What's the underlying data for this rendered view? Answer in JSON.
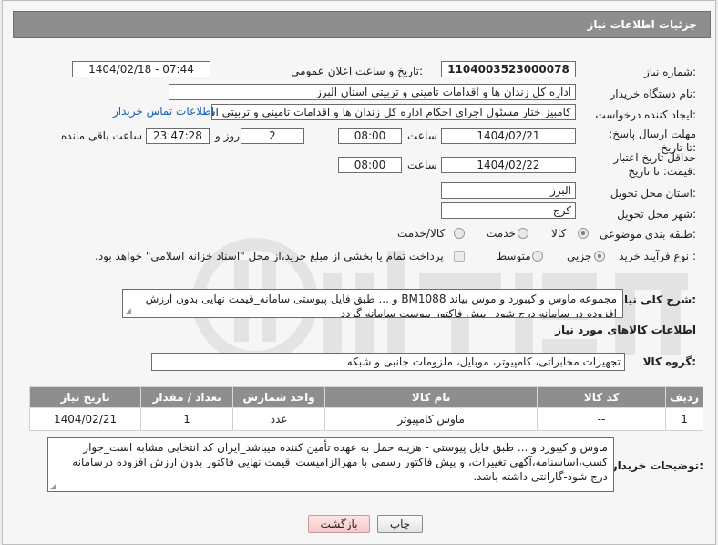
{
  "header": {
    "title": "جزئیات اطلاعات نیاز"
  },
  "labels": {
    "need_number": "شماره نیاز:",
    "announce_datetime": "تاریخ و ساعت اعلان عمومی:",
    "buyer_org": "نام دستگاه خریدار:",
    "requester": "ایجاد کننده درخواست:",
    "reply_deadline": "مهلت ارسال پاسخ: تا تاریخ:",
    "price_validity": "حداقل تاریخ اعتبار قیمت: تا تاریخ:",
    "time": "ساعت",
    "day_and": "روز و",
    "remaining": "ساعت باقی مانده",
    "province": "استان محل تحویل:",
    "city": "شهر محل تحویل:",
    "category": "طبقه بندی موضوعی:",
    "process_type": "نوع فرآیند خرید :",
    "need_desc": "شرح کلی نیاز:",
    "goods_info": "اطلاعات کالاهای مورد نیاز",
    "goods_group": "گروه کالا:",
    "buyer_notes": "توضیحات خریدار:"
  },
  "fields": {
    "need_number": "1104003523000078",
    "announce_datetime": "1404/02/18 - 07:44",
    "buyer_org": "اداره کل زندان ها و اقدامات تامینی و تربیتی استان البرز",
    "requester": "کامبیز ختار مسئول اجرای احکام اداره کل زندان ها و اقدامات تامینی و تربیتی استان البرز",
    "reply_date": "1404/02/21",
    "reply_time": "08:00",
    "reply_days": "2",
    "remaining_time": "23:47:28",
    "validity_date": "1404/02/22",
    "validity_time": "08:00",
    "province": "البرز",
    "city": "کرج",
    "need_desc": "مجموعه ماوس و کیبورد و موس بیاند BM1088 و ... طبق فایل پیوستی سامانه_قیمت نهایی بدون ارزش افزوده در سامانه درج شود_ پیش فاکتور پیوست سامانه گردد",
    "goods_group": "تجهیزات مخابراتی، کامپیوتر، موبایل، ملزومات جانبی و شبکه",
    "buyer_notes": "ماوس و کیبورد و ... طبق فایل پیوستی - هزینه حمل به عهده تأمین کننده میباشد_ایران کد انتخابی مشابه است_جواز کسب،اساسنامه،آگهی تغییرات، و پیش فاکتور رسمی با مهرالزامیست_قیمت نهایی فاکتور بدون ارزش افزوده درسامانه درج شود-گارانتی داشته باشد."
  },
  "contact_link": "اطلاعات تماس خریدار",
  "category_options": {
    "goods": "کالا",
    "service": "خدمت",
    "goods_service": "کالا/خدمت",
    "selected": "goods"
  },
  "process_options": {
    "minor": "جزیی",
    "medium": "متوسط",
    "selected": "minor"
  },
  "payment_note": "پرداخت تمام یا بخشی از مبلغ خرید،از محل \"اسناد خزانه اسلامی\" خواهد بود.",
  "table": {
    "headers": [
      "ردیف",
      "کد کالا",
      "نام کالا",
      "واحد شمارش",
      "تعداد / مقدار",
      "تاریخ نیاز"
    ],
    "rows": [
      [
        "1",
        "--",
        "ماوس کامپیوتر",
        "عدد",
        "1",
        "1404/02/21"
      ]
    ]
  },
  "buttons": {
    "print": "چاپ",
    "back": "بازگشت"
  },
  "colors": {
    "header_bg": "#8e8e8e",
    "link": "#1a5fb4",
    "back_button": "#f6c9c9"
  }
}
